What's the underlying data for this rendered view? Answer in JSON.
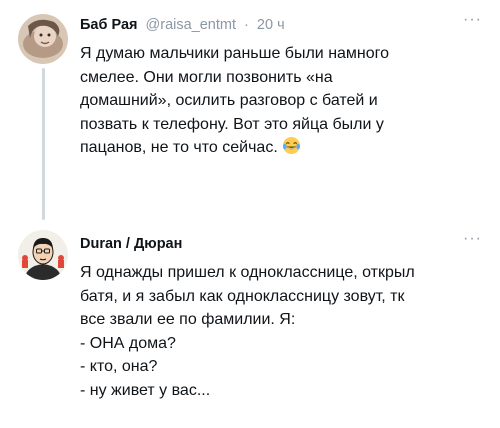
{
  "tweets": [
    {
      "author_name": "Баб Рая",
      "handle": "@raisa_entmt",
      "separator": "·",
      "time": "20 ч",
      "more": "···",
      "avatar_icon": "avatar-photo-icon",
      "lines": [
        "Я думаю мальчики раньше были намного",
        "смелее. Они могли позвонить «на",
        "домашний», осилить разговор с батей и",
        "позвать к телефону. Вот это яйца были у",
        "пацанов, не то что сейчас."
      ],
      "emoji": "tears-of-joy-emoji-icon"
    },
    {
      "author_name": "Duran / Дюран",
      "more": "···",
      "avatar_icon": "avatar-illustration-icon",
      "lines": [
        "Я однажды пришел к однокласснице, открыл",
        "батя, и я забыл как одноклассницу зовут, тк",
        "все звали ее по фамилии. Я:",
        "- ОНА дома?",
        "- кто, она?",
        "- ну живет у вас..."
      ]
    }
  ],
  "colors": {
    "text": "#0f1419",
    "secondary": "#8b98a5",
    "thread_line": "#cfd9de"
  }
}
